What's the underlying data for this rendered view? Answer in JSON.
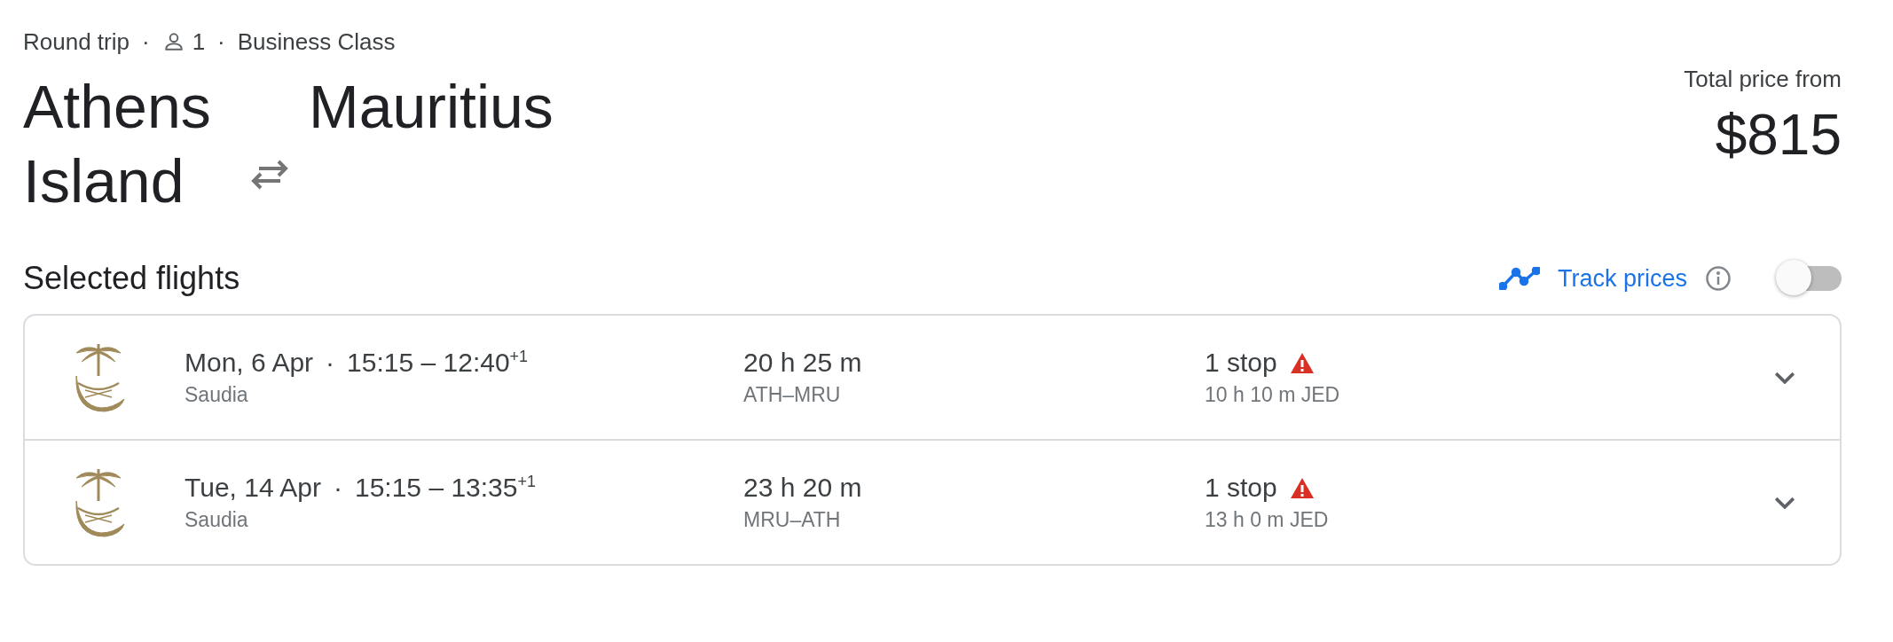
{
  "meta": [
    {
      "kind": "text",
      "text": "Round trip"
    },
    {
      "kind": "dot",
      "text": "·"
    },
    {
      "kind": "passengers",
      "text": "1"
    },
    {
      "kind": "dot",
      "text": "·"
    },
    {
      "kind": "text",
      "text": "Business Class"
    }
  ],
  "route": {
    "origin": "Athens Island",
    "destination": "Mauritius"
  },
  "price": {
    "label": "Total price from",
    "amount": "$815"
  },
  "section": {
    "title": "Selected flights",
    "track_label": "Track prices",
    "track_on": false
  },
  "flights": [
    {
      "date": "Mon, 6 Apr",
      "separator": "·",
      "times": "15:15 – 12:40$^{+1}$",
      "airline": "Saudia",
      "duration": "20 h 25 m",
      "route": "ATH–MRU",
      "stops": "1 stop",
      "warning": true,
      "layover": "10 h 10 m JED",
      "expanded": false
    },
    {
      "date": "Tue, 14 Apr",
      "separator": "·",
      "times": "15:15 – 13:35$^{+1}$",
      "airline": "Saudia",
      "duration": "23 h 20 m",
      "route": "MRU–ATH",
      "stops": "1 stop",
      "warning": true,
      "layover": "13 h 0 m JED",
      "expanded": false
    }
  ]
}
